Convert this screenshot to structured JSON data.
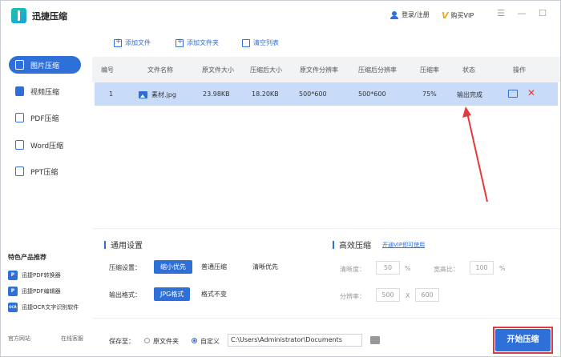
{
  "app": {
    "title": "迅捷压缩"
  },
  "header": {
    "login_label": "登录/注册",
    "vip_label": "购买VIP"
  },
  "sidebar": {
    "items": [
      {
        "label": "图片压缩"
      },
      {
        "label": "视频压缩"
      },
      {
        "label": "PDF压缩"
      },
      {
        "label": "Word压缩"
      },
      {
        "label": "PPT压缩"
      }
    ],
    "featured_title": "特色产品推荐",
    "featured": [
      {
        "label": "迅捷PDF转换器",
        "icon_text": "P"
      },
      {
        "label": "迅捷PDF编辑器",
        "icon_text": "P"
      },
      {
        "label": "迅捷OCR文字识别软件",
        "icon_text": "OCR"
      }
    ],
    "footer": {
      "site": "官方网站",
      "service": "在线客服"
    }
  },
  "toolbar": {
    "add_file": "添加文件",
    "add_folder": "添加文件夹",
    "clear_list": "清空列表"
  },
  "table": {
    "headers": [
      "编号",
      "文件名称",
      "原文件大小",
      "压缩后大小",
      "原文件分辨率",
      "压缩后分辨率",
      "压缩率",
      "状态",
      "操作"
    ],
    "rows": [
      {
        "index": "1",
        "name": "素材.jpg",
        "orig_size": "23.98KB",
        "new_size": "18.20KB",
        "orig_res": "500*600",
        "new_res": "500*600",
        "ratio": "75%",
        "status": "输出完成"
      }
    ]
  },
  "settings": {
    "general_title": "通用设置",
    "compress_label": "压缩设置：",
    "compress_options": [
      "缩小优先",
      "普通压缩",
      "清晰优先"
    ],
    "output_label": "输出格式：",
    "output_options": [
      "JPG格式",
      "格式不变"
    ],
    "efficient_title": "高效压缩",
    "vip_link": "开通VIP即可使用",
    "clarity_label": "清晰度：",
    "clarity_value": "50",
    "clarity_unit": "%",
    "aspect_label": "宽高比：",
    "aspect_value": "100",
    "aspect_unit": "%",
    "resolution_label": "分辨率：",
    "res_width": "500",
    "res_x": "X",
    "res_height": "600"
  },
  "bottom": {
    "save_label": "保存至：",
    "option_original": "原文件夹",
    "option_custom": "自定义",
    "path": "C:\\Users\\Administrator\\Documents",
    "start_button": "开始压缩"
  },
  "colors": {
    "accent": "#2f6fd8",
    "highlight_row": "#c8dcf9",
    "annotation_red": "#e23b3b"
  }
}
